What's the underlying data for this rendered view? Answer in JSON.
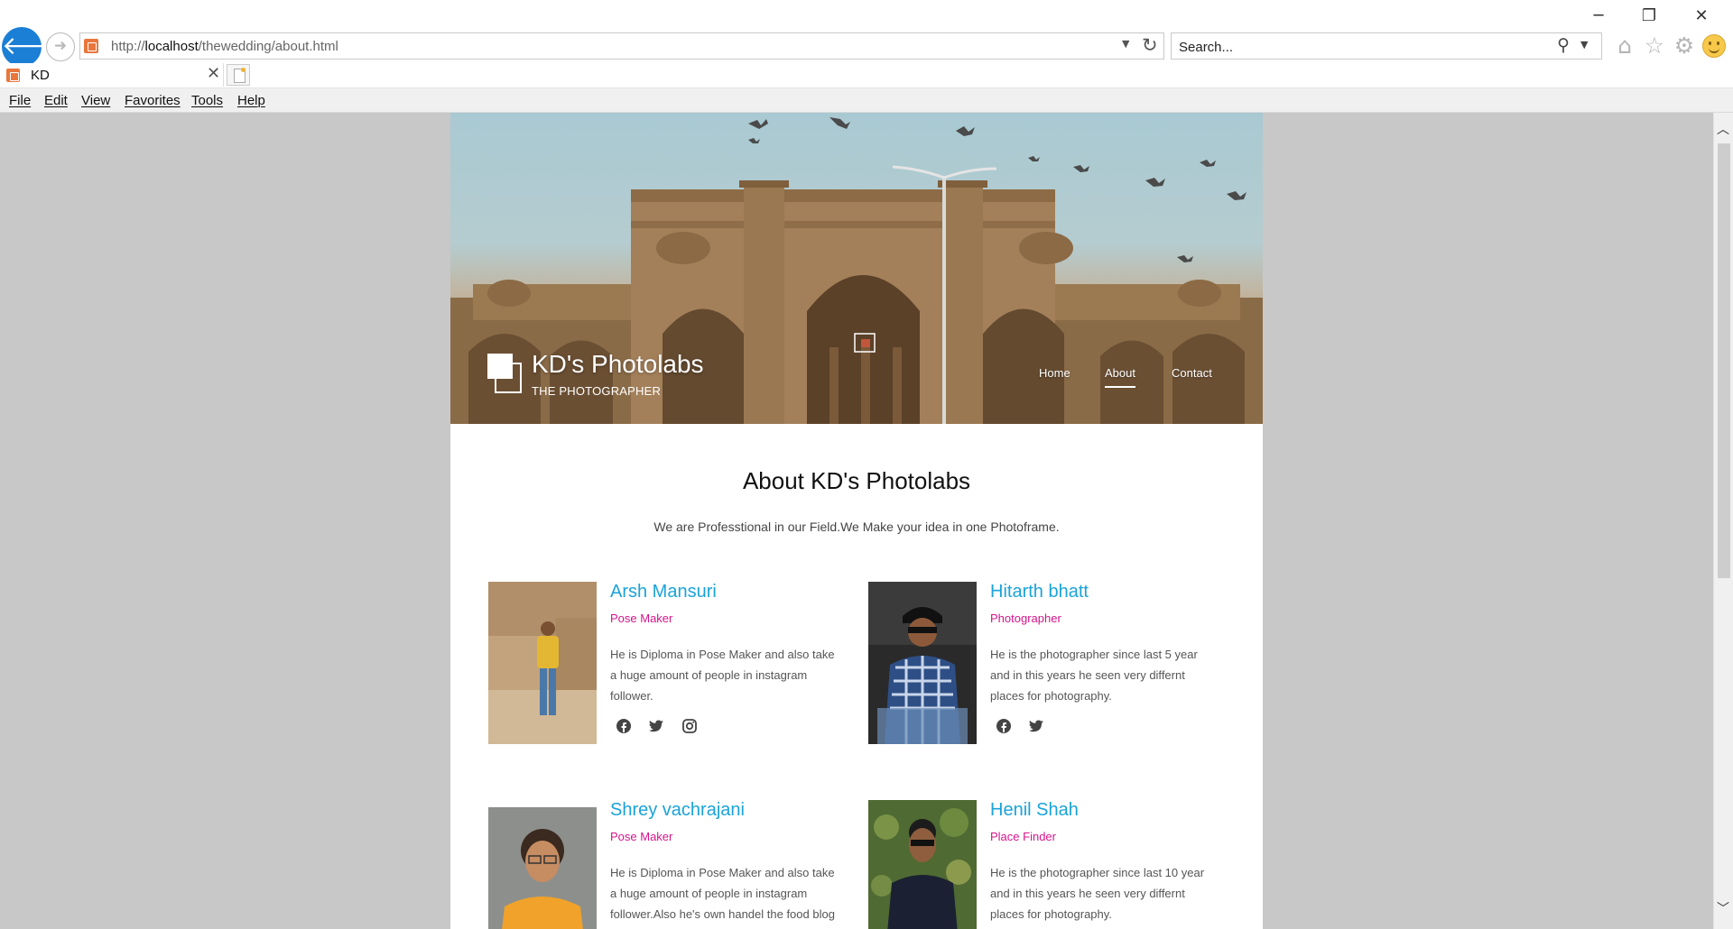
{
  "browser": {
    "window_controls": {
      "minimize": "─",
      "maximize": "❐",
      "close": "✕"
    },
    "address_bar": {
      "url_prefix": "http://",
      "url_host": "localhost",
      "url_path": "/thewedding/about.html"
    },
    "search_bar": {
      "placeholder": "Search..."
    },
    "tab": {
      "title": "KD"
    },
    "menu": [
      "File",
      "Edit",
      "View",
      "Favorites",
      "Tools",
      "Help"
    ],
    "icons": [
      "back-arrow-icon",
      "forward-arrow-icon",
      "refresh-icon",
      "search-icon",
      "home-icon",
      "star-icon",
      "gear-icon",
      "smiley-icon"
    ]
  },
  "site": {
    "title": "KD's Photolabs",
    "tagline": "THE PHOTOGRAPHER",
    "nav": [
      "Home",
      "About",
      "Contact"
    ],
    "active_nav": "About",
    "accent_color": "#1aa3d9",
    "role_color": "#d4148b"
  },
  "about": {
    "heading": "About KD's Photolabs",
    "subtitle": "We are Professtional in our Field.We Make your idea in one Photoframe."
  },
  "team": [
    {
      "name": "Arsh Mansuri",
      "role": "Pose Maker",
      "bio": "He is Diploma in Pose Maker and also take a huge amount of people in instagram follower.",
      "social": [
        "facebook-icon",
        "twitter-icon",
        "instagram-icon"
      ]
    },
    {
      "name": "Hitarth bhatt",
      "role": "Photographer",
      "bio": "He is the photographer since last 5 year and in this years he seen very differnt places for photography.",
      "social": [
        "facebook-icon",
        "twitter-icon"
      ]
    },
    {
      "name": "Shrey vachrajani",
      "role": "Pose Maker",
      "bio": "He is Diploma in Pose Maker and also take a huge amount of people in instagram follower.Also he's own handel the food blog in instagram."
    },
    {
      "name": "Henil Shah",
      "role": "Place Finder",
      "bio": "He is the photographer since last 10 year and in this years he seen very differnt places for photography."
    }
  ]
}
